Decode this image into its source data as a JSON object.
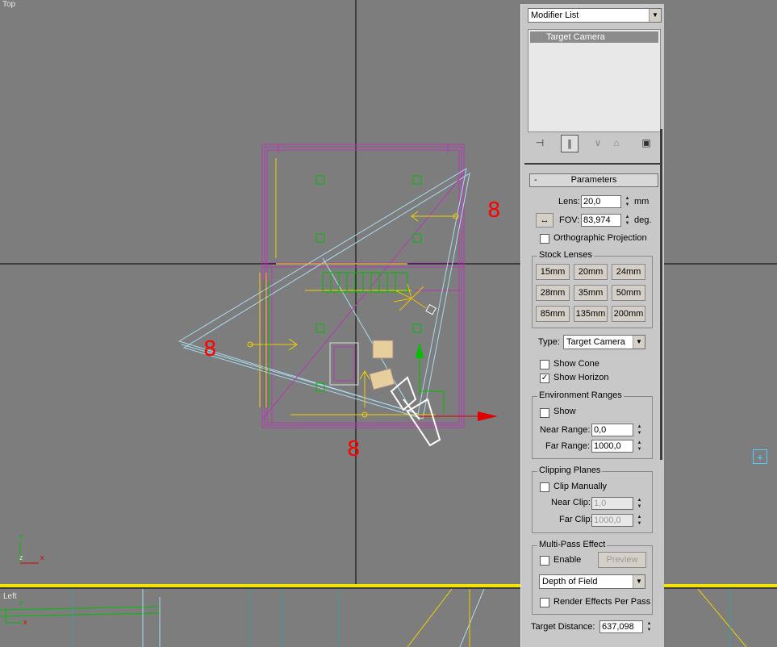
{
  "viewports": {
    "top_label": "Top",
    "left_label": "Left",
    "numbers": [
      "8",
      "8",
      "8"
    ],
    "axis_top": {
      "y": "y",
      "z": "z",
      "x": "x"
    },
    "axis_left": {
      "z": "z",
      "x": "x"
    }
  },
  "panel": {
    "modifier_list": "Modifier List",
    "stack_item": "Target Camera",
    "toolbar_icons": [
      "pin-stack-icon",
      "show-end-result-icon",
      "make-unique-icon",
      "remove-modifier-icon",
      "configure-modifier-sets-icon"
    ],
    "parameters": {
      "title": "Parameters",
      "collapse": "-",
      "lens_label": "Lens:",
      "lens_value": "20,0",
      "lens_unit": "mm",
      "fov_label": "FOV:",
      "fov_value": "83,974",
      "fov_unit": "deg.",
      "ortho_label": "Orthographic Projection",
      "ortho_checked": false,
      "stock_title": "Stock Lenses",
      "stock_lenses": [
        "15mm",
        "20mm",
        "24mm",
        "28mm",
        "35mm",
        "50mm",
        "85mm",
        "135mm",
        "200mm"
      ],
      "type_label": "Type:",
      "type_value": "Target Camera",
      "show_cone_label": "Show Cone",
      "show_cone_checked": false,
      "show_horizon_label": "Show Horizon",
      "show_horizon_checked": true,
      "env_title": "Environment Ranges",
      "env_show_label": "Show",
      "near_range_label": "Near Range:",
      "near_range_value": "0,0",
      "far_range_label": "Far Range:",
      "far_range_value": "1000,0",
      "clip_title": "Clipping Planes",
      "clip_manual_label": "Clip Manually",
      "near_clip_label": "Near Clip:",
      "near_clip_value": "1,0",
      "far_clip_label": "Far Clip:",
      "far_clip_value": "1000,0",
      "mp_title": "Multi-Pass Effect",
      "enable_label": "Enable",
      "preview_label": "Preview",
      "effect_value": "Depth of Field",
      "render_effects_label": "Render Effects Per Pass",
      "target_distance_label": "Target Distance:",
      "target_distance_value": "637,098"
    }
  },
  "colors": {
    "viewport_bg": "#7d7d7d",
    "active_border": "#f5e400",
    "walls": "#b43ab4",
    "camera": "#a8dcf0",
    "light": "#f0d000",
    "helper": "#00c000",
    "numbers": "#ff0000"
  }
}
